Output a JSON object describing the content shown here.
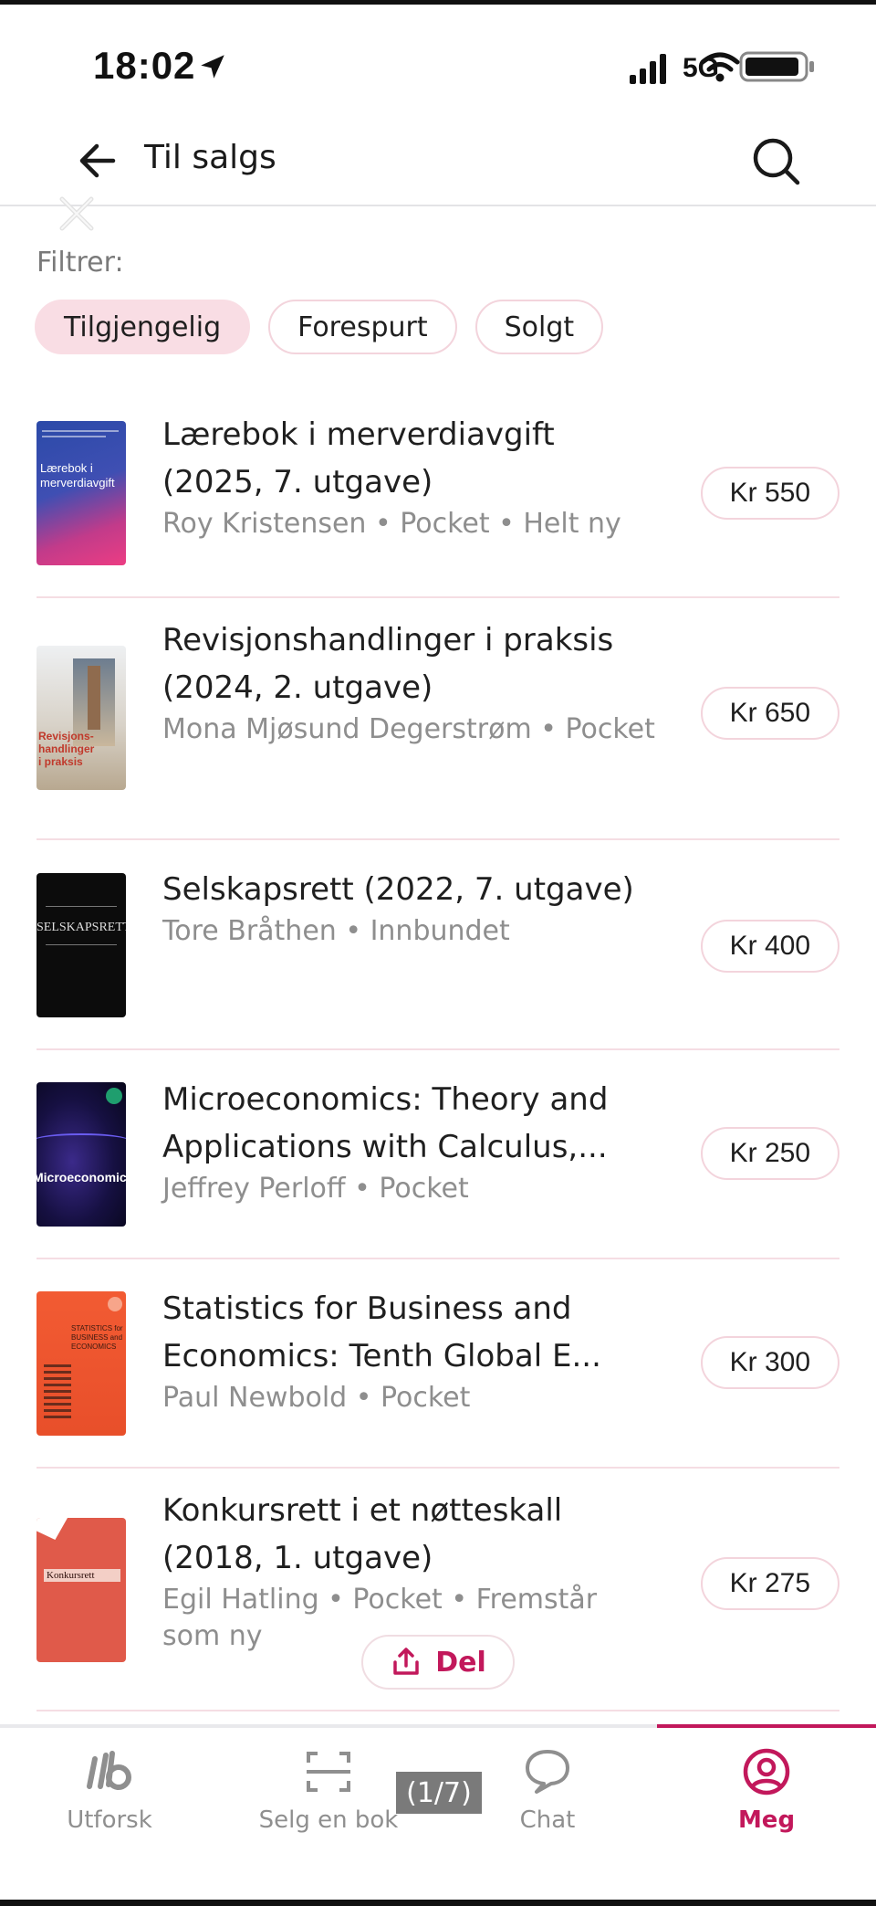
{
  "status_bar": {
    "time": "18:02",
    "network": "5G"
  },
  "header": {
    "title": "Til salgs"
  },
  "filters": {
    "label": "Filtrer:",
    "chips": [
      {
        "label": "Tilgjengelig",
        "active": true
      },
      {
        "label": "Forespurt",
        "active": false
      },
      {
        "label": "Solgt",
        "active": false
      }
    ]
  },
  "listings": [
    {
      "title": "Lærebok i merverdiavgift (2025, 7. utgave)",
      "meta": "Roy Kristensen • Pocket • Helt ny",
      "price": "Kr 550",
      "cover_text": "Lærebok i merverdiavgift"
    },
    {
      "title": "Revisjonshandlinger i praksis (2024, 2. utgave)",
      "meta": "Mona Mjøsund Degerstrøm • Pocket",
      "price": "Kr 650",
      "cover_text": "Revisjons-handlinger i praksis"
    },
    {
      "title": "Selskapsrett (2022, 7. utgave)",
      "meta": "Tore Bråthen • Innbundet",
      "price": "Kr 400",
      "cover_text": "SELSKAPSRETT"
    },
    {
      "title": "Microeconomics: Theory and Applications with Calculus,...",
      "meta": "Jeffrey Perloff • Pocket",
      "price": "Kr 250",
      "cover_text": "Microeconomics"
    },
    {
      "title": "Statistics for Business and Economics: Tenth Global E...",
      "meta": "Paul Newbold • Pocket",
      "price": "Kr 300",
      "cover_text": "STATISTICS for BUSINESS and ECONOMICS"
    },
    {
      "title": "Konkursrett i et nøtteskall (2018, 1. utgave)",
      "meta": "Egil Hatling • Pocket • Fremstår som ny",
      "price": "Kr 275",
      "cover_text": "Konkursrett"
    }
  ],
  "share": {
    "label": "Del"
  },
  "bottom_nav": {
    "items": [
      {
        "label": "Utforsk",
        "icon": "logo-icon",
        "active": false
      },
      {
        "label": "Selg en bok",
        "icon": "scan-icon",
        "active": false
      },
      {
        "label": "Chat",
        "icon": "chat-bubble-icon",
        "active": false
      },
      {
        "label": "Meg",
        "icon": "profile-icon",
        "active": true
      }
    ]
  },
  "overlay": {
    "counter": "(1/7)"
  },
  "colors": {
    "accent": "#c2185b",
    "chip_active_bg": "#f9dde4",
    "chip_border": "#f3d4dc",
    "divider": "#f5dde3"
  }
}
